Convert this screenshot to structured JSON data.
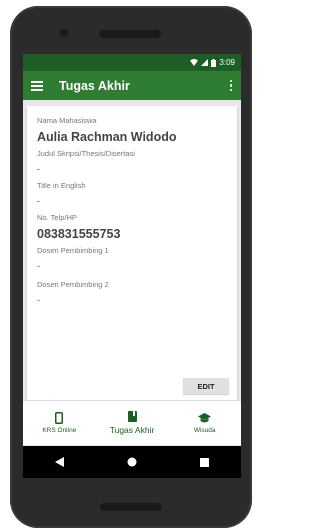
{
  "statusbar": {
    "time": "3:09"
  },
  "appbar": {
    "title": "Tugas Akhir"
  },
  "fields": [
    {
      "label": "Nama Mahasiswa",
      "value": "Aulia Rachman Widodo"
    },
    {
      "label": "Judul Skripsi/Thesis/Disertasi",
      "value": "-"
    },
    {
      "label": "Title in English",
      "value": "-"
    },
    {
      "label": "No. Telp/HP",
      "value": "083831555753"
    },
    {
      "label": "Dosen Pembimbing 1",
      "value": "-"
    },
    {
      "label": "Dosen Pembimbing 2",
      "value": "-"
    }
  ],
  "edit_label": "EDIT",
  "bottom_nav": [
    {
      "label": "KRS Online",
      "icon": "phone-icon"
    },
    {
      "label": "Tugas Akhir",
      "icon": "book-icon"
    },
    {
      "label": "Wisuda",
      "icon": "graduation-cap-icon"
    }
  ],
  "colors": {
    "primary": "#2e7d32",
    "statusbar": "#1e5e26"
  }
}
